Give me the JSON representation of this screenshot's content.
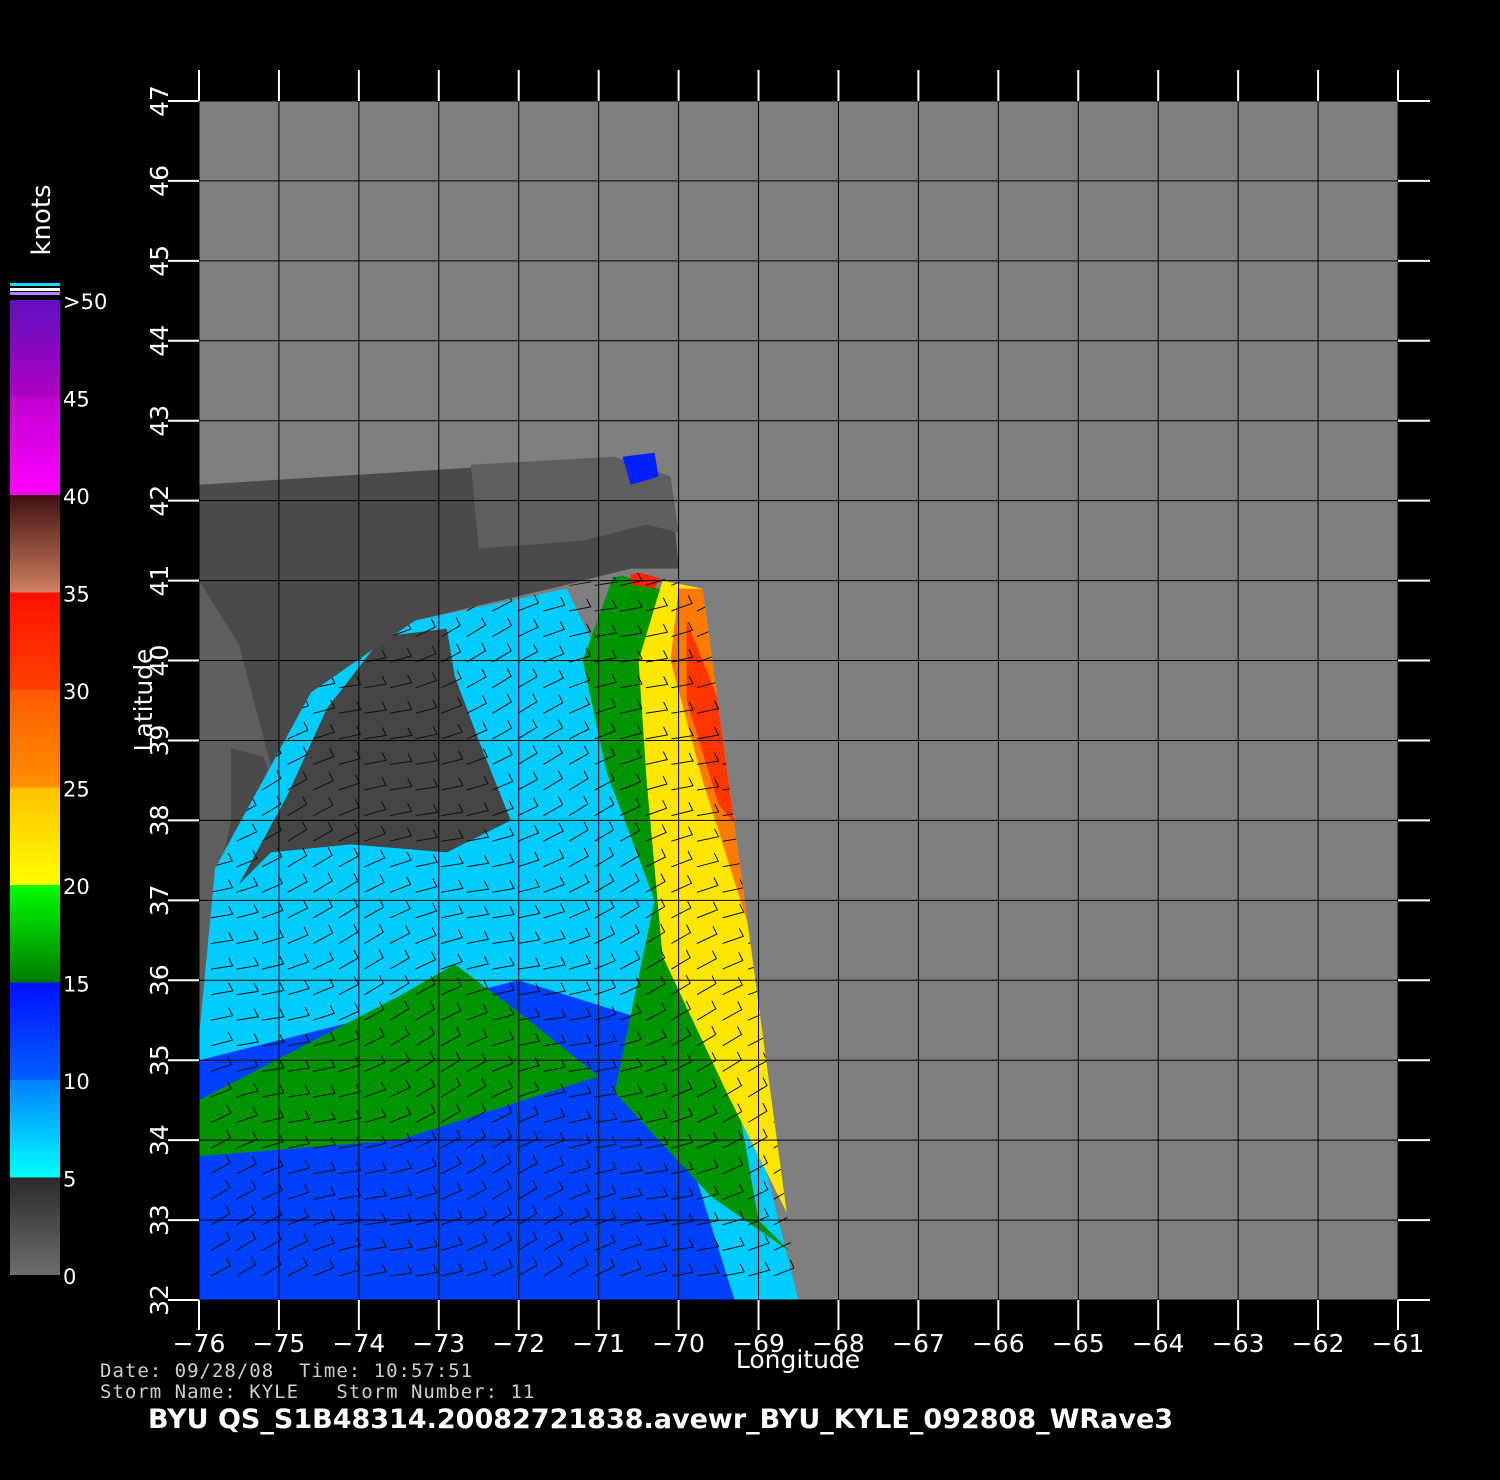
{
  "chart_data": {
    "type": "heatmap",
    "subtype": "scatterometer wind-speed map with wind barbs",
    "xlabel": "Longitude",
    "ylabel": "Latitude",
    "xlim": [
      -76,
      -61
    ],
    "ylim": [
      32,
      47
    ],
    "x_ticks": [
      -76,
      -75,
      -74,
      -73,
      -72,
      -71,
      -70,
      -69,
      -68,
      -67,
      -66,
      -65,
      -64,
      -63,
      -62,
      -61
    ],
    "y_ticks": [
      32,
      33,
      34,
      35,
      36,
      37,
      38,
      39,
      40,
      41,
      42,
      43,
      44,
      45,
      46,
      47
    ],
    "x_tick_labels": [
      "−76",
      "−75",
      "−74",
      "−73",
      "−72",
      "−71",
      "−70",
      "−69",
      "−68",
      "−67",
      "−66",
      "−65",
      "−64",
      "−63",
      "−62",
      "−61"
    ],
    "y_tick_labels": [
      "32",
      "33",
      "34",
      "35",
      "36",
      "37",
      "38",
      "39",
      "40",
      "41",
      "42",
      "43",
      "44",
      "45",
      "46",
      "47"
    ],
    "grid": true,
    "colorbar": {
      "unit": "knots",
      "placement": "left",
      "labels": [
        "0",
        "5",
        "10",
        "15",
        "20",
        "25",
        "30",
        "35",
        "40",
        "45",
        ">50"
      ],
      "segments": [
        {
          "from": 0,
          "to": 5,
          "colors": [
            "#6e6e6e",
            "#2a2a2a"
          ]
        },
        {
          "from": 5,
          "to": 10,
          "colors": [
            "#00ffff",
            "#0080ff"
          ]
        },
        {
          "from": 10,
          "to": 15,
          "colors": [
            "#0060ff",
            "#0010ff"
          ]
        },
        {
          "from": 15,
          "to": 20,
          "colors": [
            "#007a00",
            "#00ff00"
          ]
        },
        {
          "from": 20,
          "to": 25,
          "colors": [
            "#ffff00",
            "#ffc000"
          ]
        },
        {
          "from": 25,
          "to": 30,
          "colors": [
            "#ff9000",
            "#ff5a00"
          ]
        },
        {
          "from": 30,
          "to": 35,
          "colors": [
            "#ff4000",
            "#ff1000"
          ]
        },
        {
          "from": 35,
          "to": 40,
          "colors": [
            "#d08060",
            "#401010"
          ]
        },
        {
          "from": 40,
          "to": 45,
          "colors": [
            "#ff00ff",
            "#c000d0"
          ]
        },
        {
          "from": 45,
          "to": 50,
          "colors": [
            "#b000c0",
            "#6010c0"
          ]
        }
      ]
    },
    "background_gray": "#7f7f7f",
    "land_dark": "#4a4a4a",
    "land_mid": "#5e5e5e",
    "swath_polygon": [
      [
        -76,
        32
      ],
      [
        -68.5,
        32
      ],
      [
        -69.7,
        40.9
      ],
      [
        -70.5,
        41.1
      ],
      [
        -71.6,
        40.9
      ],
      [
        -73.3,
        40.5
      ],
      [
        -74.6,
        39.6
      ],
      [
        -75.8,
        37.4
      ],
      [
        -76,
        35.3
      ]
    ],
    "wind_zones": [
      {
        "speed": 7,
        "poly": [
          [
            -76,
            32
          ],
          [
            -68.5,
            32
          ],
          [
            -70.0,
            38
          ],
          [
            -71.4,
            40.9
          ],
          [
            -73.3,
            40.5
          ],
          [
            -74.6,
            39.6
          ],
          [
            -75.8,
            37.4
          ],
          [
            -76,
            35.3
          ]
        ]
      },
      {
        "speed": 12,
        "poly": [
          [
            -76,
            32
          ],
          [
            -69.3,
            32
          ],
          [
            -70.4,
            35.5
          ],
          [
            -72,
            36
          ],
          [
            -74,
            35.5
          ],
          [
            -76,
            35.0
          ]
        ]
      },
      {
        "speed": 16,
        "poly": [
          [
            -76,
            34.5
          ],
          [
            -73.5,
            35.8
          ],
          [
            -72.8,
            36.2
          ],
          [
            -72.0,
            35.6
          ],
          [
            -71.0,
            34.8
          ],
          [
            -73.5,
            34.0
          ],
          [
            -76,
            33.8
          ]
        ]
      },
      {
        "speed": 16,
        "poly": [
          [
            -70.8,
            41.1
          ],
          [
            -70.0,
            40.8
          ],
          [
            -69.7,
            37.0
          ],
          [
            -69.0,
            33.0
          ],
          [
            -68.6,
            32.6
          ],
          [
            -69.6,
            33.3
          ],
          [
            -70.8,
            34.6
          ],
          [
            -70.3,
            37.0
          ],
          [
            -70.9,
            38.6
          ],
          [
            -71.2,
            40.0
          ]
        ]
      },
      {
        "speed": 22,
        "poly": [
          [
            -70.2,
            41.0
          ],
          [
            -69.7,
            40.9
          ],
          [
            -68.8,
            34.5
          ],
          [
            -68.6,
            33.0
          ],
          [
            -69.4,
            34.6
          ],
          [
            -70.2,
            36.3
          ],
          [
            -70.4,
            38.5
          ],
          [
            -70.5,
            40.0
          ]
        ]
      },
      {
        "speed": 27,
        "poly": [
          [
            -70.0,
            40.9
          ],
          [
            -69.7,
            40.9
          ],
          [
            -68.6,
            35.8
          ],
          [
            -69.1,
            36.6
          ],
          [
            -69.7,
            38.5
          ],
          [
            -70.1,
            40.0
          ]
        ]
      },
      {
        "speed": 31,
        "poly": [
          [
            -69.9,
            40.5
          ],
          [
            -69.5,
            39.5
          ],
          [
            -68.9,
            37.5
          ],
          [
            -69.5,
            38.2
          ],
          [
            -69.9,
            39.5
          ]
        ]
      },
      {
        "speed": 33,
        "poly": [
          [
            -70.6,
            41.1
          ],
          [
            -70.2,
            41.1
          ],
          [
            -70.3,
            40.9
          ],
          [
            -70.6,
            40.95
          ]
        ]
      },
      {
        "speed": 14,
        "poly": [
          [
            -70.7,
            42.55
          ],
          [
            -70.3,
            42.6
          ],
          [
            -70.25,
            42.3
          ],
          [
            -70.6,
            42.2
          ]
        ]
      },
      {
        "speed": 3,
        "poly": [
          [
            -73.7,
            40.3
          ],
          [
            -72.9,
            40.4
          ],
          [
            -72.8,
            39.8
          ],
          [
            -72.5,
            39.0
          ],
          [
            -72.1,
            38.0
          ],
          [
            -72.9,
            37.6
          ],
          [
            -74.1,
            37.7
          ],
          [
            -75.1,
            37.6
          ],
          [
            -75.5,
            37.2
          ],
          [
            -74.9,
            38.3
          ],
          [
            -74.4,
            39.4
          ]
        ]
      }
    ],
    "land_polygons": [
      {
        "shade": "dark",
        "poly": [
          [
            -76,
            32
          ],
          [
            -76,
            42.2
          ],
          [
            -72,
            42.45
          ],
          [
            -70.8,
            42.55
          ],
          [
            -70.1,
            42.3
          ],
          [
            -70.0,
            41.15
          ],
          [
            -70.6,
            41.15
          ],
          [
            -71.6,
            40.9
          ],
          [
            -73.3,
            40.5
          ],
          [
            -74.6,
            39.6
          ],
          [
            -75.8,
            37.4
          ],
          [
            -76,
            35.3
          ]
        ]
      },
      {
        "shade": "mid",
        "poly": [
          [
            -76,
            34.3
          ],
          [
            -76,
            41.0
          ],
          [
            -75.5,
            40.2
          ],
          [
            -75.0,
            38.3
          ],
          [
            -75.2,
            38.8
          ],
          [
            -75.6,
            38.9
          ],
          [
            -75.6,
            38.0
          ],
          [
            -75.8,
            37.0
          ],
          [
            -75.6,
            36.2
          ],
          [
            -75.8,
            35.5
          ]
        ]
      },
      {
        "shade": "mid",
        "poly": [
          [
            -72.6,
            42.45
          ],
          [
            -70.8,
            42.55
          ],
          [
            -70.1,
            42.3
          ],
          [
            -70.0,
            41.6
          ],
          [
            -70.4,
            41.7
          ],
          [
            -71.2,
            41.5
          ],
          [
            -72.5,
            41.4
          ]
        ]
      }
    ],
    "barb_region_speed_hint": "barbs drawn over the observed swath"
  },
  "meta": {
    "date_line": "Date: 09/28/08  Time: 10:57:51",
    "storm_line": "Storm Name: KYLE   Storm Number: 11",
    "file_name": "BYU QS_S1B48314.20082721838.avewr_BYU_KYLE_092808_WRave3"
  }
}
